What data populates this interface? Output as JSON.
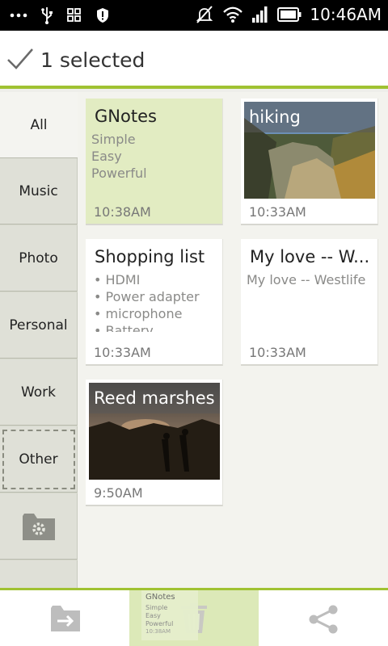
{
  "status": {
    "time": "10:46AM"
  },
  "action_bar": {
    "title": "1 selected"
  },
  "categories": [
    "All",
    "Music",
    "Photo",
    "Personal",
    "Work",
    "Other"
  ],
  "notes": [
    {
      "title": "GNotes",
      "body": [
        "Simple",
        "Easy",
        "Powerful"
      ],
      "time": "10:38AM"
    },
    {
      "title": "hiking",
      "time": "10:33AM"
    },
    {
      "title": "Shopping list",
      "body": [
        "• HDMI",
        "• Power adapter",
        "• microphone",
        "• Batterv"
      ],
      "time": "10:33AM"
    },
    {
      "title": "My love -- W...",
      "body": [
        "My love -- Westlife"
      ],
      "time": "10:33AM"
    },
    {
      "title": "Reed marshes",
      "time": "9:50AM"
    }
  ],
  "drag_preview": {
    "title": "GNotes",
    "body": [
      "Simple",
      "Easy",
      "Powerful"
    ],
    "time": "10:38AM"
  },
  "colors": {
    "accent": "#a0c232",
    "selected_card": "#e2ecc2"
  }
}
